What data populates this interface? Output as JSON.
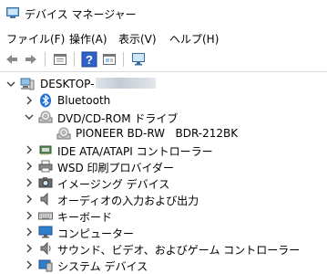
{
  "window": {
    "title": "デバイス マネージャー"
  },
  "menu": [
    {
      "label": "ファイル(F)"
    },
    {
      "label": "操作(A)"
    },
    {
      "label": "表示(V)"
    },
    {
      "label": "ヘルプ(H)"
    }
  ],
  "toolbar": {
    "buttons": [
      "back-icon",
      "forward-icon",
      "properties-icon",
      "help-icon",
      "view-icon",
      "scan-monitor-icon"
    ]
  },
  "tree": {
    "root": {
      "label": "DESKTOP-"
    },
    "items": [
      {
        "label": "Bluetooth",
        "icon": "bluetooth-icon",
        "expanded": false
      },
      {
        "label": "DVD/CD-ROM ドライブ",
        "icon": "optical-drive-icon",
        "expanded": true
      },
      {
        "label": "PIONEER BD-RW   BDR-212BK",
        "icon": "optical-drive-icon",
        "child": true
      },
      {
        "label": "IDE ATA/ATAPI コントローラー",
        "icon": "ide-controller-icon",
        "expanded": false
      },
      {
        "label": "WSD 印刷プロバイダー",
        "icon": "printer-icon",
        "expanded": false
      },
      {
        "label": "イメージング デバイス",
        "icon": "camera-icon",
        "expanded": false
      },
      {
        "label": "オーディオの入力および出力",
        "icon": "speaker-icon",
        "expanded": false
      },
      {
        "label": "キーボード",
        "icon": "keyboard-icon",
        "expanded": false
      },
      {
        "label": "コンピューター",
        "icon": "computer-icon",
        "expanded": false
      },
      {
        "label": "サウンド、ビデオ、およびゲーム コントローラー",
        "icon": "sound-icon",
        "expanded": false
      },
      {
        "label": "システム デバイス",
        "icon": "system-device-icon",
        "expanded": false
      }
    ]
  },
  "colors": {
    "accent": "#0078d7",
    "chevron": "#404040"
  }
}
